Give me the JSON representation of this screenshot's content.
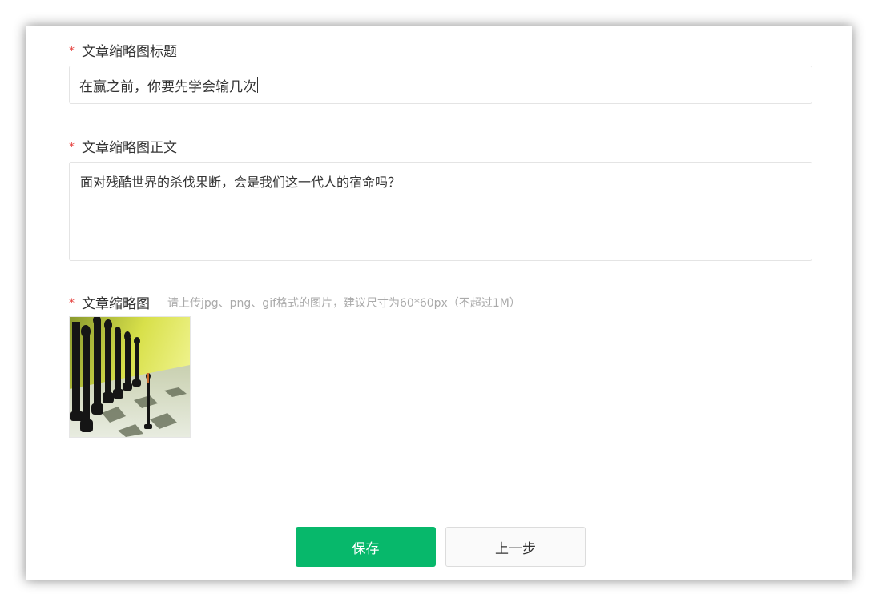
{
  "form": {
    "title_field": {
      "required_mark": "*",
      "label": "文章缩略图标题",
      "value": "在赢之前，你要先学会输几次"
    },
    "body_field": {
      "required_mark": "*",
      "label": "文章缩略图正文",
      "value": "面对残酷世界的杀伐果断，会是我们这一代人的宿命吗？"
    },
    "image_field": {
      "required_mark": "*",
      "label": "文章缩略图",
      "hint": "请上传jpg、png、gif格式的图片，建议尺寸为60*60px（不超过1M）",
      "image_icon": "chess-thumbnail"
    }
  },
  "footer": {
    "save_label": "保存",
    "prev_label": "上一步"
  },
  "colors": {
    "required": "#e64340",
    "primary": "#07b86b",
    "border": "#e4e4e4"
  }
}
